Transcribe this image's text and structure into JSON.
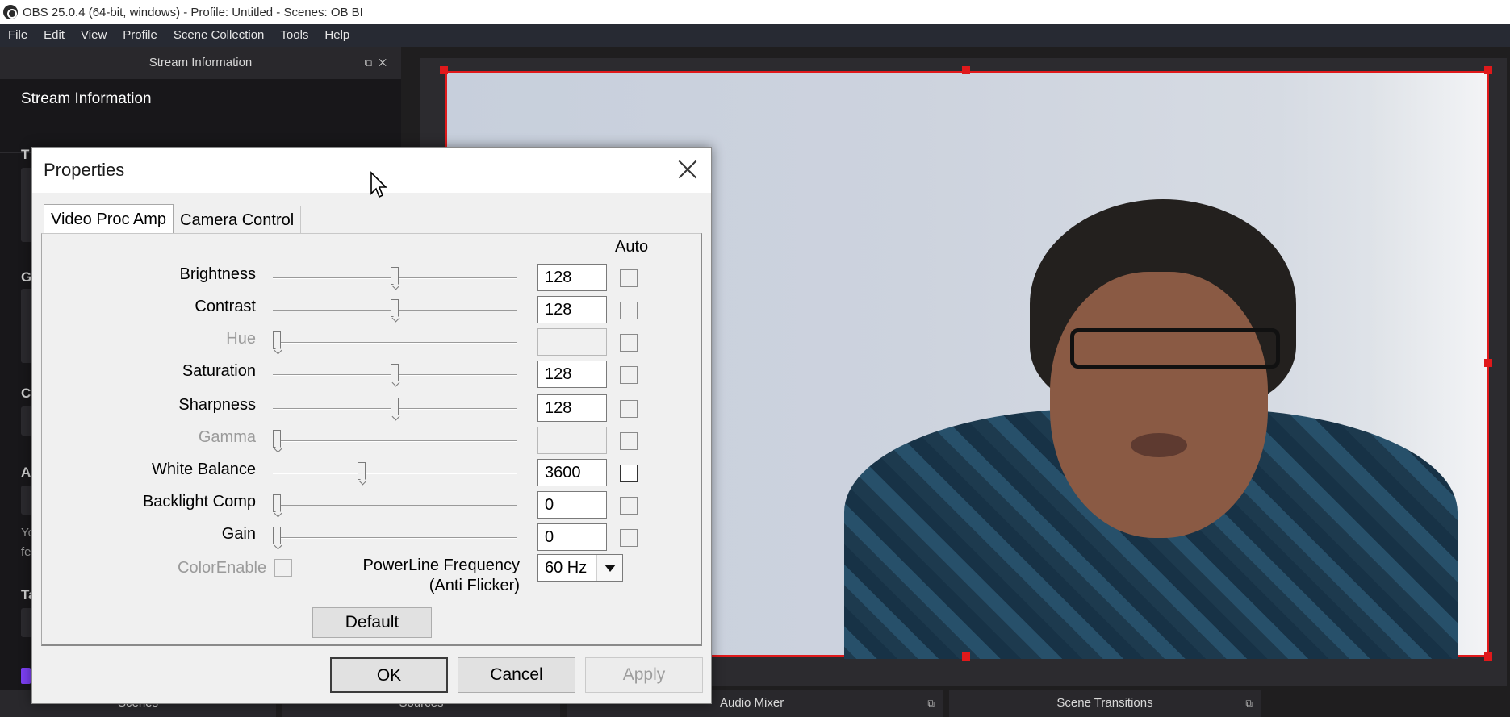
{
  "window": {
    "title": "OBS 25.0.4 (64-bit, windows) - Profile: Untitled - Scenes: OB BI"
  },
  "menu": [
    "File",
    "Edit",
    "View",
    "Profile",
    "Scene Collection",
    "Tools",
    "Help"
  ],
  "left_dock": {
    "title": "Stream Information",
    "heading": "Stream Information",
    "peek_letters": [
      "T",
      "G",
      "C",
      "A",
      "Ta"
    ],
    "peek_small": [
      "Yo",
      "fe"
    ]
  },
  "bottom_docks": [
    "Scenes",
    "Sources",
    "Audio Mixer",
    "Scene Transitions"
  ],
  "dialog": {
    "title": "Properties",
    "tabs": [
      "Video Proc Amp",
      "Camera Control"
    ],
    "auto_label": "Auto",
    "rows": [
      {
        "label": "Brightness",
        "value": "128",
        "enabled": true,
        "level": 0.5,
        "auto": false
      },
      {
        "label": "Contrast",
        "value": "128",
        "enabled": true,
        "level": 0.5,
        "auto": false
      },
      {
        "label": "Hue",
        "value": "",
        "enabled": false,
        "level": 0.0,
        "auto": false
      },
      {
        "label": "Saturation",
        "value": "128",
        "enabled": true,
        "level": 0.5,
        "auto": false
      },
      {
        "label": "Sharpness",
        "value": "128",
        "enabled": true,
        "level": 0.5,
        "auto": false
      },
      {
        "label": "Gamma",
        "value": "",
        "enabled": false,
        "level": 0.0,
        "auto": false
      },
      {
        "label": "White Balance",
        "value": "3600",
        "enabled": true,
        "level": 0.36,
        "auto": false,
        "auto_enabled": true
      },
      {
        "label": "Backlight Comp",
        "value": "0",
        "enabled": true,
        "level": 0.0,
        "auto": false
      },
      {
        "label": "Gain",
        "value": "0",
        "enabled": true,
        "level": 0.0,
        "auto": false
      }
    ],
    "color_enable_label": "ColorEnable",
    "powerline_label_line1": "PowerLine Frequency",
    "powerline_label_line2": "(Anti Flicker)",
    "powerline_value": "60 Hz",
    "default_button": "Default",
    "ok_button": "OK",
    "cancel_button": "Cancel",
    "apply_button": "Apply"
  },
  "colors": {
    "selection_border": "#e0191b",
    "menubar_bg": "#272a33",
    "dock_bg": "#18171a",
    "dialog_bg": "#f0f0f0"
  }
}
